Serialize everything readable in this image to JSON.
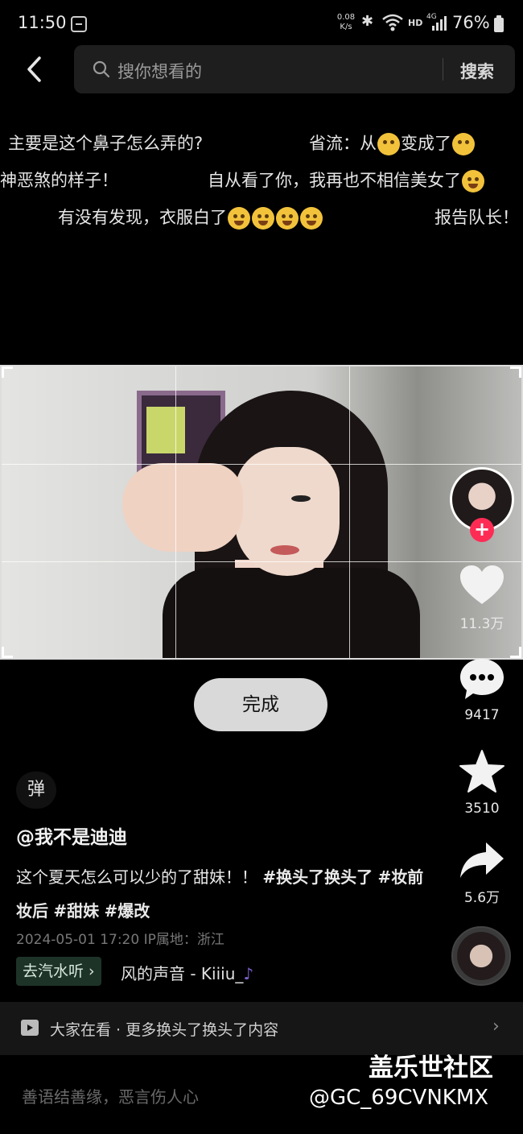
{
  "status_bar": {
    "time": "11:50",
    "net_speed_value": "0.08",
    "net_speed_unit": "K/s",
    "hd": "HD",
    "network": "4G",
    "battery": "76%"
  },
  "search": {
    "placeholder": "搜你想看的",
    "submit_label": "搜索"
  },
  "danmaku": [
    {
      "text": "主要是这个鼻子怎么弄的?"
    },
    {
      "text_before": "省流：从",
      "text_mid": "变成了"
    },
    {
      "text": "神恶煞的样子！"
    },
    {
      "text": "自从看了你，我再也不相信美女了"
    },
    {
      "text": "有没有发现，衣服白了"
    },
    {
      "text": "报告队长！"
    }
  ],
  "video": {
    "done_label": "完成"
  },
  "actions": {
    "likes": "11.3万",
    "comments": "9417",
    "favorites": "3510",
    "shares": "5.6万"
  },
  "danmaku_toggle": "弹",
  "post": {
    "author": "@我不是迪迪",
    "desc_text": "这个夏天怎么可以少的了甜妹！！",
    "tags": [
      "#换头了换头了",
      "#妆前妆后",
      "#甜妹",
      "#爆改"
    ],
    "date": "2024-05-01 17:20",
    "ip": "IP属地：浙江",
    "music_chip": "去汽水听 ›",
    "music_title": "风的声音 - Kiiiu_",
    "music_note": "♪"
  },
  "related": {
    "text": "大家在看 · 更多换头了换头了内容",
    "chevron": "›"
  },
  "comment_placeholder": "善语结善缘，恶言伤人心",
  "watermark": {
    "title": "盖乐世社区",
    "id": "@GC_69CVNKMX"
  },
  "colors": {
    "accent": "#fe2c55",
    "background": "#000000",
    "music_chip_bg": "#1e3328"
  },
  "icons": [
    "back-arrow-icon",
    "search-icon",
    "heart-icon",
    "comment-icon",
    "star-icon",
    "share-icon",
    "plus-icon",
    "play-icon",
    "chevron-right-icon"
  ]
}
